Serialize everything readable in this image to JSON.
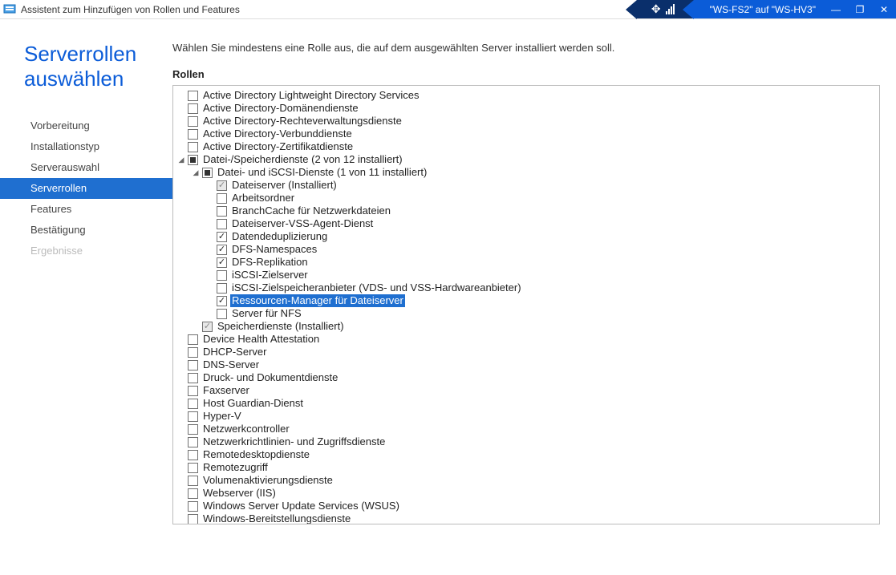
{
  "window": {
    "app_title": "Assistent zum Hinzufügen von Rollen und Features",
    "hv_host": "\"WS-FS2\" auf \"WS-HV3\""
  },
  "page": {
    "title": "Serverrollen auswählen",
    "instruction": "Wählen Sie mindestens eine Rolle aus, die auf dem ausgewählten Server installiert werden soll.",
    "section_label": "Rollen"
  },
  "nav": {
    "items": [
      {
        "label": "Vorbereitung",
        "active": false,
        "disabled": false
      },
      {
        "label": "Installationstyp",
        "active": false,
        "disabled": false
      },
      {
        "label": "Serverauswahl",
        "active": false,
        "disabled": false
      },
      {
        "label": "Serverrollen",
        "active": true,
        "disabled": false
      },
      {
        "label": "Features",
        "active": false,
        "disabled": false
      },
      {
        "label": "Bestätigung",
        "active": false,
        "disabled": false
      },
      {
        "label": "Ergebnisse",
        "active": false,
        "disabled": true
      }
    ]
  },
  "roles": [
    {
      "indent": 1,
      "state": "unchecked",
      "label": "Active Directory Lightweight Directory Services"
    },
    {
      "indent": 1,
      "state": "unchecked",
      "label": "Active Directory-Domänendienste"
    },
    {
      "indent": 1,
      "state": "unchecked",
      "label": "Active Directory-Rechteverwaltungsdienste"
    },
    {
      "indent": 1,
      "state": "unchecked",
      "label": "Active Directory-Verbunddienste"
    },
    {
      "indent": 1,
      "state": "unchecked",
      "label": "Active Directory-Zertifikatdienste"
    },
    {
      "indent": 1,
      "state": "indet",
      "label": "Datei-/Speicherdienste (2 von 12 installiert)",
      "expander": "open"
    },
    {
      "indent": 2,
      "state": "indet",
      "label": "Datei- und iSCSI-Dienste (1 von 11 installiert)",
      "expander": "open"
    },
    {
      "indent": 3,
      "state": "locked",
      "label": "Dateiserver (Installiert)"
    },
    {
      "indent": 3,
      "state": "unchecked",
      "label": "Arbeitsordner"
    },
    {
      "indent": 3,
      "state": "unchecked",
      "label": "BranchCache für Netzwerkdateien"
    },
    {
      "indent": 3,
      "state": "unchecked",
      "label": "Dateiserver-VSS-Agent-Dienst"
    },
    {
      "indent": 3,
      "state": "checked",
      "label": "Datendeduplizierung"
    },
    {
      "indent": 3,
      "state": "checked",
      "label": "DFS-Namespaces"
    },
    {
      "indent": 3,
      "state": "checked",
      "label": "DFS-Replikation"
    },
    {
      "indent": 3,
      "state": "unchecked",
      "label": "iSCSI-Zielserver"
    },
    {
      "indent": 3,
      "state": "unchecked",
      "label": "iSCSI-Zielspeicheranbieter (VDS- und VSS-Hardwareanbieter)"
    },
    {
      "indent": 3,
      "state": "checked",
      "label": "Ressourcen-Manager für Dateiserver",
      "selected": true
    },
    {
      "indent": 3,
      "state": "unchecked",
      "label": "Server für NFS"
    },
    {
      "indent": 2,
      "state": "locked",
      "label": "Speicherdienste (Installiert)"
    },
    {
      "indent": 1,
      "state": "unchecked",
      "label": "Device Health Attestation"
    },
    {
      "indent": 1,
      "state": "unchecked",
      "label": "DHCP-Server"
    },
    {
      "indent": 1,
      "state": "unchecked",
      "label": "DNS-Server"
    },
    {
      "indent": 1,
      "state": "unchecked",
      "label": "Druck- und Dokumentdienste"
    },
    {
      "indent": 1,
      "state": "unchecked",
      "label": "Faxserver"
    },
    {
      "indent": 1,
      "state": "unchecked",
      "label": "Host Guardian-Dienst"
    },
    {
      "indent": 1,
      "state": "unchecked",
      "label": "Hyper-V"
    },
    {
      "indent": 1,
      "state": "unchecked",
      "label": "Netzwerkcontroller"
    },
    {
      "indent": 1,
      "state": "unchecked",
      "label": "Netzwerkrichtlinien- und Zugriffsdienste"
    },
    {
      "indent": 1,
      "state": "unchecked",
      "label": "Remotedesktopdienste"
    },
    {
      "indent": 1,
      "state": "unchecked",
      "label": "Remotezugriff"
    },
    {
      "indent": 1,
      "state": "unchecked",
      "label": "Volumenaktivierungsdienste"
    },
    {
      "indent": 1,
      "state": "unchecked",
      "label": "Webserver (IIS)"
    },
    {
      "indent": 1,
      "state": "unchecked",
      "label": "Windows Server Update Services (WSUS)"
    },
    {
      "indent": 1,
      "state": "unchecked",
      "label": "Windows-Bereitstellungsdienste"
    }
  ]
}
